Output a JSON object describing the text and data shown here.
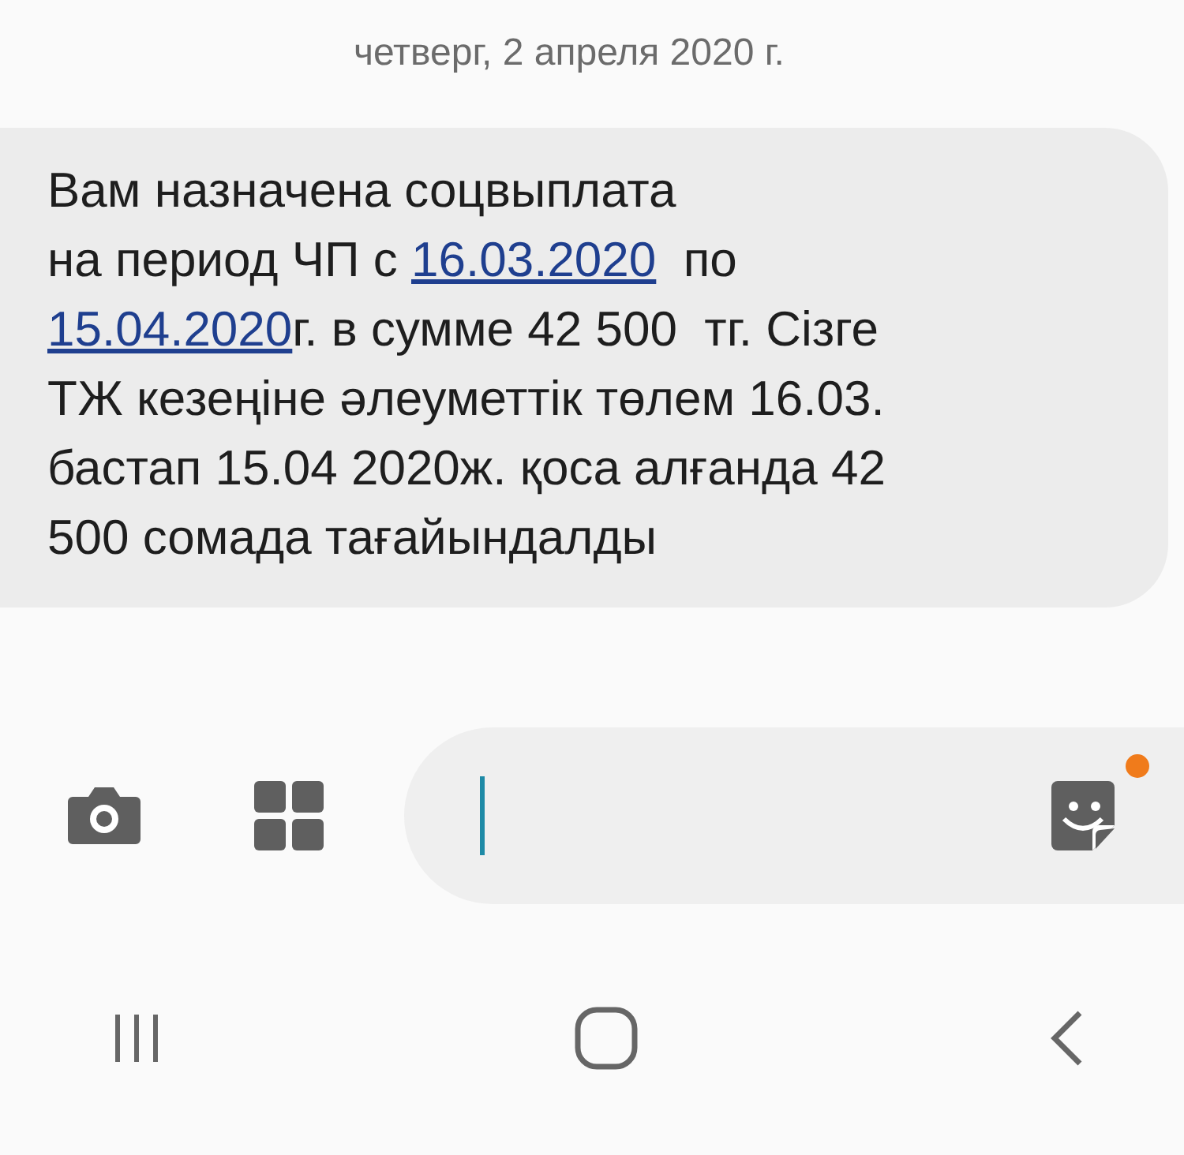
{
  "date_header": "четверг, 2 апреля 2020 г.",
  "message": {
    "lines": [
      [
        {
          "kind": "text",
          "text": "Вам назначена соцвыплата"
        }
      ],
      [
        {
          "kind": "text",
          "text": "на период ЧП с "
        },
        {
          "kind": "link",
          "text": "16.03.2020"
        },
        {
          "kind": "text",
          "text": "  по"
        }
      ],
      [
        {
          "kind": "link",
          "text": "15.04.2020"
        },
        {
          "kind": "text",
          "text": "г. в сумме 42 500  тг. Сізге"
        }
      ],
      [
        {
          "kind": "text",
          "text": "ТЖ кезеңіне әлеуметтік төлем 16.03."
        }
      ],
      [
        {
          "kind": "text",
          "text": "бастап 15.04 2020ж. қоса алғанда 42"
        }
      ],
      [
        {
          "kind": "text",
          "text": "500 сомада тағайындалды"
        }
      ]
    ]
  },
  "composer": {
    "sticker_badge": true
  }
}
